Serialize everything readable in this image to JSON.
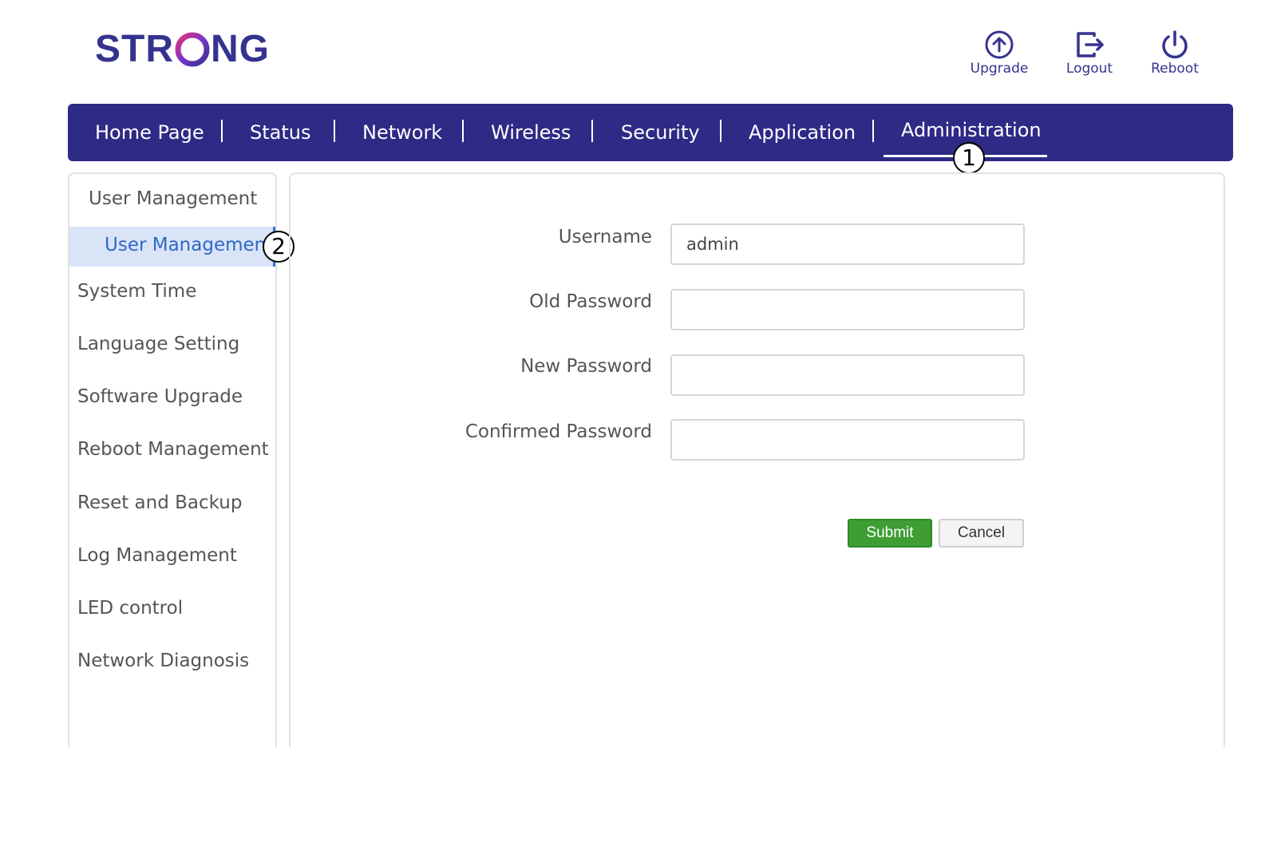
{
  "brand": {
    "logo_text": "STRONG",
    "accent": "#35338f"
  },
  "header_actions": [
    {
      "icon": "upgrade-icon",
      "label": "Upgrade"
    },
    {
      "icon": "logout-icon",
      "label": "Logout"
    },
    {
      "icon": "power-icon",
      "label": "Reboot"
    }
  ],
  "nav": {
    "items": [
      "Home Page",
      "Status",
      "Network",
      "Wireless",
      "Security",
      "Application",
      "Administration"
    ],
    "active": "Administration",
    "background": "#2e2a86"
  },
  "markers": [
    "1",
    "2"
  ],
  "sidebar": {
    "group": "User Management",
    "active_item": "User Management",
    "items": [
      "System Time",
      "Language Setting",
      "Software Upgrade",
      "Reboot Management",
      "Reset and Backup",
      "Log Management",
      "LED control",
      "Network Diagnosis"
    ]
  },
  "form": {
    "username_label": "Username",
    "username_value": "admin",
    "old_password_label": "Old Password",
    "new_password_label": "New Password",
    "confirm_password_label": "Confirmed Password",
    "submit_label": "Submit",
    "cancel_label": "Cancel"
  },
  "colors": {
    "submit": "#3e9e34",
    "active_sidebar_bg": "#d9e4f7",
    "active_sidebar_text": "#2f68c6"
  }
}
